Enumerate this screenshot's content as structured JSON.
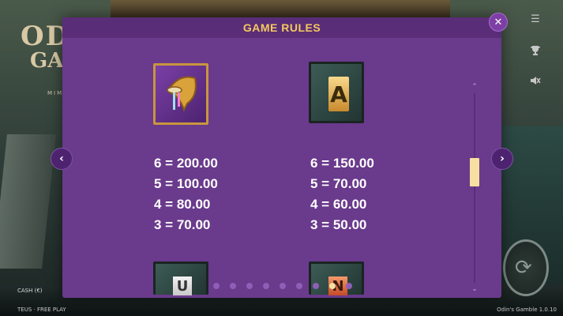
{
  "modal": {
    "title": "GAME RULES",
    "close_glyph": "✕",
    "prev_glyph": "‹",
    "next_glyph": "›"
  },
  "symbols": [
    {
      "name": "horn",
      "icon": "horn-icon",
      "payouts": [
        "6 = 200.00",
        "5 = 100.00",
        "4 = 80.00",
        "3 = 70.00"
      ]
    },
    {
      "name": "rune-a",
      "icon": "rune-a-icon",
      "glyph": "A",
      "payouts": [
        "6 = 150.00",
        "5 = 70.00",
        "4 = 60.00",
        "3 = 50.00"
      ]
    },
    {
      "name": "rune-white",
      "icon": "rune-white-icon",
      "glyph": "U"
    },
    {
      "name": "rune-red",
      "icon": "rune-red-icon",
      "glyph": "N"
    }
  ],
  "pagination": {
    "total": 9,
    "active": 7
  },
  "scrollbar": {
    "position": 0.4,
    "up": "⌃",
    "down": "⌄"
  },
  "background": {
    "logo_line1": "ODI",
    "logo_line2": "GAM",
    "logo_line3": "MIMIR",
    "cash_label": "CASH (€)",
    "free_play": "TEUS · FREE PLAY",
    "version": "Odin's Gamble 1.0.10"
  },
  "side_icons": [
    "menu-icon",
    "trophy-icon",
    "mute-icon"
  ],
  "colors": {
    "modal_bg": "#6a3a8c",
    "title": "#f4c95e",
    "active_dot": "#f6dfa0"
  }
}
